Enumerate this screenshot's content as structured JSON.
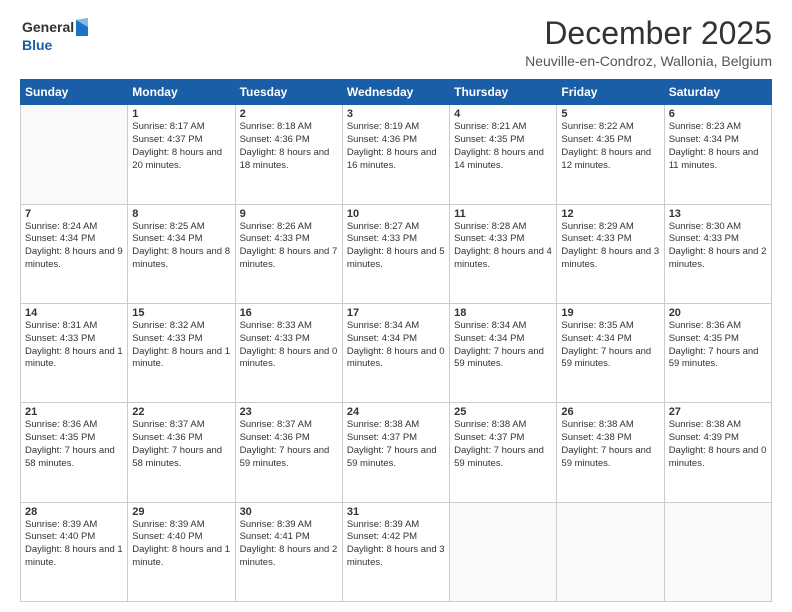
{
  "logo": {
    "line1": "General",
    "line2": "Blue"
  },
  "title": "December 2025",
  "subtitle": "Neuville-en-Condroz, Wallonia, Belgium",
  "days_header": [
    "Sunday",
    "Monday",
    "Tuesday",
    "Wednesday",
    "Thursday",
    "Friday",
    "Saturday"
  ],
  "weeks": [
    [
      {
        "day": "",
        "info": ""
      },
      {
        "day": "1",
        "info": "Sunrise: 8:17 AM\nSunset: 4:37 PM\nDaylight: 8 hours\nand 20 minutes."
      },
      {
        "day": "2",
        "info": "Sunrise: 8:18 AM\nSunset: 4:36 PM\nDaylight: 8 hours\nand 18 minutes."
      },
      {
        "day": "3",
        "info": "Sunrise: 8:19 AM\nSunset: 4:36 PM\nDaylight: 8 hours\nand 16 minutes."
      },
      {
        "day": "4",
        "info": "Sunrise: 8:21 AM\nSunset: 4:35 PM\nDaylight: 8 hours\nand 14 minutes."
      },
      {
        "day": "5",
        "info": "Sunrise: 8:22 AM\nSunset: 4:35 PM\nDaylight: 8 hours\nand 12 minutes."
      },
      {
        "day": "6",
        "info": "Sunrise: 8:23 AM\nSunset: 4:34 PM\nDaylight: 8 hours\nand 11 minutes."
      }
    ],
    [
      {
        "day": "7",
        "info": "Sunrise: 8:24 AM\nSunset: 4:34 PM\nDaylight: 8 hours\nand 9 minutes."
      },
      {
        "day": "8",
        "info": "Sunrise: 8:25 AM\nSunset: 4:34 PM\nDaylight: 8 hours\nand 8 minutes."
      },
      {
        "day": "9",
        "info": "Sunrise: 8:26 AM\nSunset: 4:33 PM\nDaylight: 8 hours\nand 7 minutes."
      },
      {
        "day": "10",
        "info": "Sunrise: 8:27 AM\nSunset: 4:33 PM\nDaylight: 8 hours\nand 5 minutes."
      },
      {
        "day": "11",
        "info": "Sunrise: 8:28 AM\nSunset: 4:33 PM\nDaylight: 8 hours\nand 4 minutes."
      },
      {
        "day": "12",
        "info": "Sunrise: 8:29 AM\nSunset: 4:33 PM\nDaylight: 8 hours\nand 3 minutes."
      },
      {
        "day": "13",
        "info": "Sunrise: 8:30 AM\nSunset: 4:33 PM\nDaylight: 8 hours\nand 2 minutes."
      }
    ],
    [
      {
        "day": "14",
        "info": "Sunrise: 8:31 AM\nSunset: 4:33 PM\nDaylight: 8 hours\nand 1 minute."
      },
      {
        "day": "15",
        "info": "Sunrise: 8:32 AM\nSunset: 4:33 PM\nDaylight: 8 hours\nand 1 minute."
      },
      {
        "day": "16",
        "info": "Sunrise: 8:33 AM\nSunset: 4:33 PM\nDaylight: 8 hours\nand 0 minutes."
      },
      {
        "day": "17",
        "info": "Sunrise: 8:34 AM\nSunset: 4:34 PM\nDaylight: 8 hours\nand 0 minutes."
      },
      {
        "day": "18",
        "info": "Sunrise: 8:34 AM\nSunset: 4:34 PM\nDaylight: 7 hours\nand 59 minutes."
      },
      {
        "day": "19",
        "info": "Sunrise: 8:35 AM\nSunset: 4:34 PM\nDaylight: 7 hours\nand 59 minutes."
      },
      {
        "day": "20",
        "info": "Sunrise: 8:36 AM\nSunset: 4:35 PM\nDaylight: 7 hours\nand 59 minutes."
      }
    ],
    [
      {
        "day": "21",
        "info": "Sunrise: 8:36 AM\nSunset: 4:35 PM\nDaylight: 7 hours\nand 58 minutes."
      },
      {
        "day": "22",
        "info": "Sunrise: 8:37 AM\nSunset: 4:36 PM\nDaylight: 7 hours\nand 58 minutes."
      },
      {
        "day": "23",
        "info": "Sunrise: 8:37 AM\nSunset: 4:36 PM\nDaylight: 7 hours\nand 59 minutes."
      },
      {
        "day": "24",
        "info": "Sunrise: 8:38 AM\nSunset: 4:37 PM\nDaylight: 7 hours\nand 59 minutes."
      },
      {
        "day": "25",
        "info": "Sunrise: 8:38 AM\nSunset: 4:37 PM\nDaylight: 7 hours\nand 59 minutes."
      },
      {
        "day": "26",
        "info": "Sunrise: 8:38 AM\nSunset: 4:38 PM\nDaylight: 7 hours\nand 59 minutes."
      },
      {
        "day": "27",
        "info": "Sunrise: 8:38 AM\nSunset: 4:39 PM\nDaylight: 8 hours\nand 0 minutes."
      }
    ],
    [
      {
        "day": "28",
        "info": "Sunrise: 8:39 AM\nSunset: 4:40 PM\nDaylight: 8 hours\nand 1 minute."
      },
      {
        "day": "29",
        "info": "Sunrise: 8:39 AM\nSunset: 4:40 PM\nDaylight: 8 hours\nand 1 minute."
      },
      {
        "day": "30",
        "info": "Sunrise: 8:39 AM\nSunset: 4:41 PM\nDaylight: 8 hours\nand 2 minutes."
      },
      {
        "day": "31",
        "info": "Sunrise: 8:39 AM\nSunset: 4:42 PM\nDaylight: 8 hours\nand 3 minutes."
      },
      {
        "day": "",
        "info": ""
      },
      {
        "day": "",
        "info": ""
      },
      {
        "day": "",
        "info": ""
      }
    ]
  ]
}
